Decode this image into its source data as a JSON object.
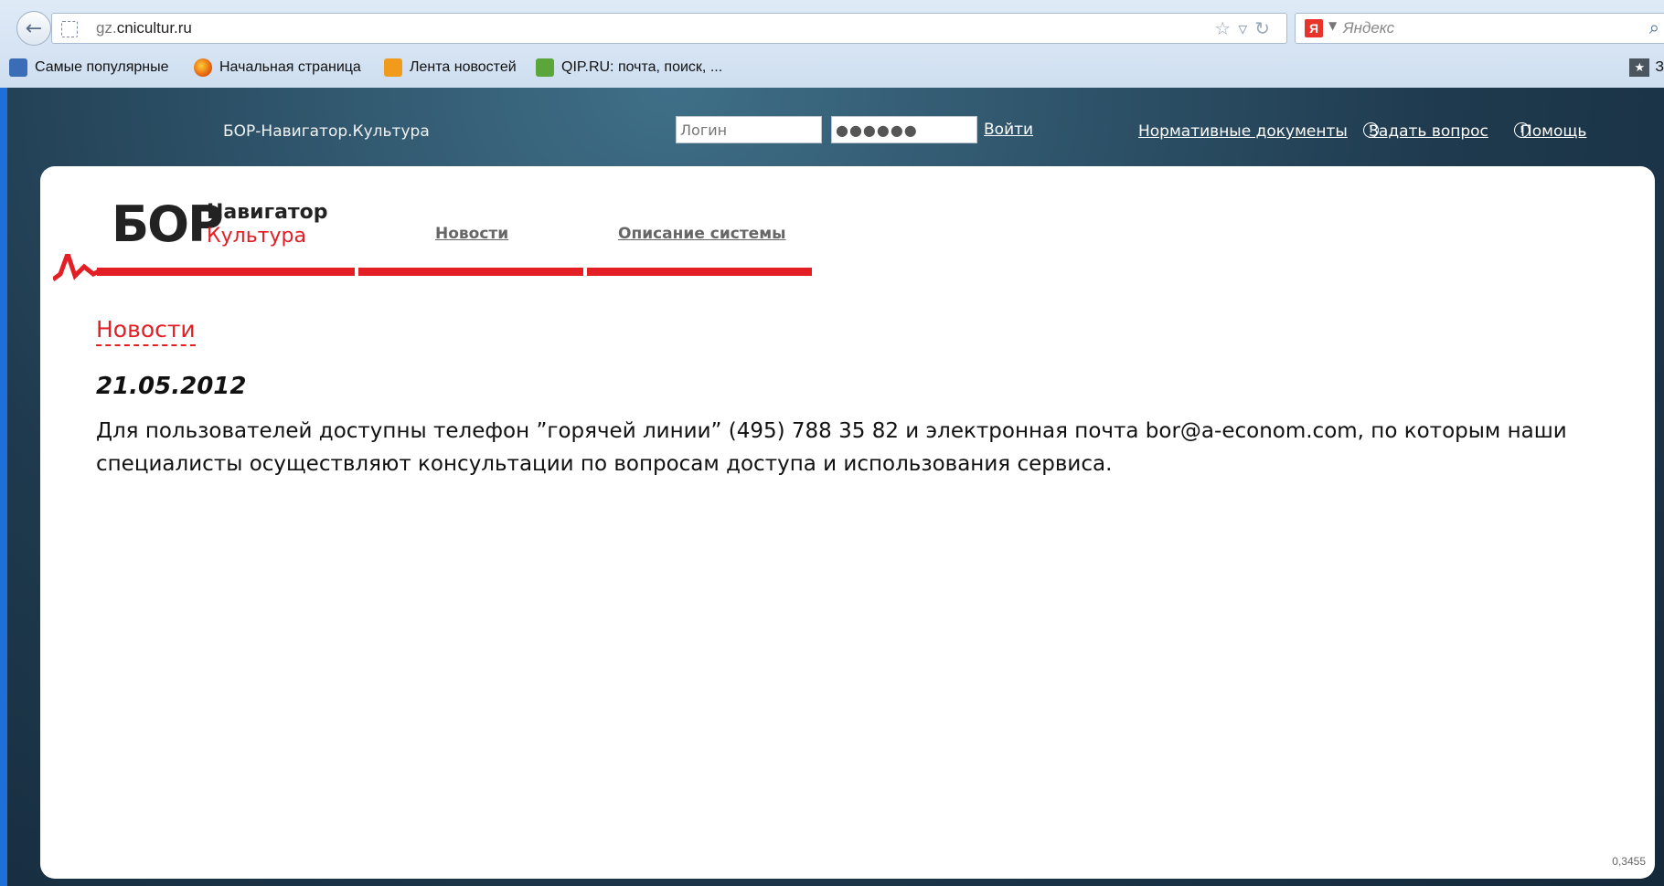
{
  "browser": {
    "url_prefix": "gz.",
    "url_domain": "cnicultur.ru",
    "search_placeholder": "Яндекс",
    "bookmarks": [
      {
        "label": "Самые популярные"
      },
      {
        "label": "Начальная страница"
      },
      {
        "label": "Лента новостей"
      },
      {
        "label": "QIP.RU: почта, поиск, ..."
      }
    ],
    "bookmarks_right": "З"
  },
  "site": {
    "title": "БОР-Навигатор.Культура",
    "login_placeholder": "Логин",
    "password_value": "●●●●●●",
    "login_button": "Войти",
    "top_nav": {
      "docs": "Нормативные документы",
      "ask": "Задать вопрос",
      "help": "Помощь"
    },
    "logo": {
      "main": "БОР",
      "line1": "Навигатор",
      "line2": "Культура"
    },
    "menu": {
      "news": "Новости",
      "description": "Описание системы"
    },
    "section_title": "Новости",
    "news": {
      "date": "21.05.2012",
      "text": "Для пользователей доступны телефон ”горячей линии” (495) 788 35 82 и электронная почта bor@a-econom.com, по которым наши специалисты осуществляют консультации по вопросам доступа и использования сервиса."
    },
    "footer_number": "0,3455"
  },
  "colors": {
    "accent_red": "#e31e24",
    "header_dark": "#1f3a4e"
  }
}
